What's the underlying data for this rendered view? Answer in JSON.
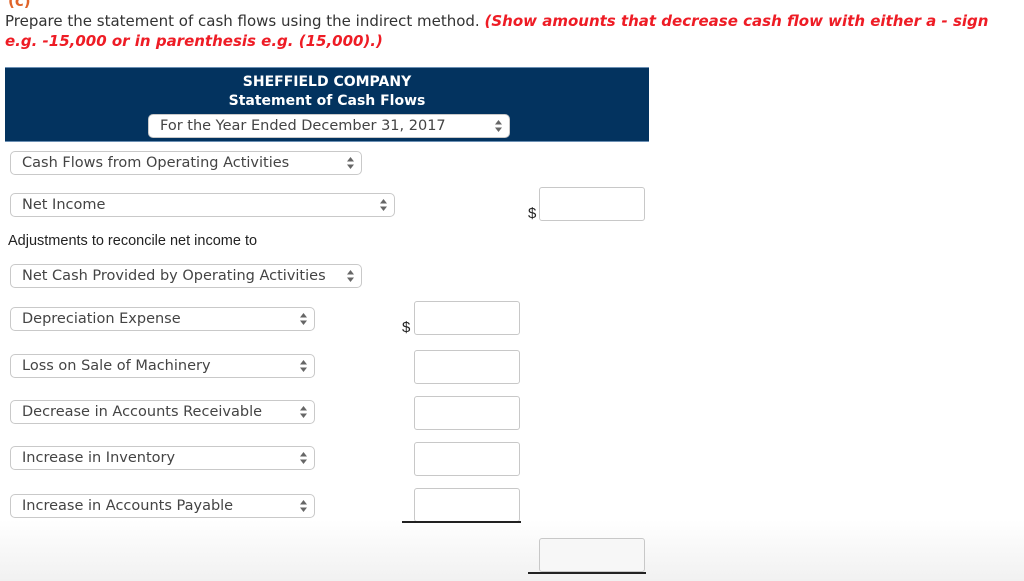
{
  "instructions": {
    "top_clipped": "(c)",
    "text": "Prepare the statement of cash flows using the indirect method.",
    "note": "(Show amounts that decrease cash flow with either a - sign e.g. -15,000 or in parenthesis e.g. (15,000).)"
  },
  "header": {
    "company": "SHEFFIELD COMPANY",
    "statement": "Statement of Cash Flows",
    "period_select": "For the Year Ended December 31, 2017",
    "bg_color": "#03335f"
  },
  "section_select": "Cash Flows from Operating Activities",
  "net_income": {
    "select": "Net Income",
    "currency": "$",
    "value": ""
  },
  "adjustments_label": "Adjustments to reconcile net income to",
  "adjustments_select": "Net Cash Provided by Operating Activities",
  "adjustments": [
    {
      "select": "Depreciation Expense",
      "currency": "$",
      "value": ""
    },
    {
      "select": "Loss on Sale of Machinery",
      "currency": "",
      "value": ""
    },
    {
      "select": "Decrease in Accounts Receivable",
      "currency": "",
      "value": ""
    },
    {
      "select": "Increase in Inventory",
      "currency": "",
      "value": ""
    },
    {
      "select": "Increase in Accounts Payable",
      "currency": "",
      "value": ""
    }
  ],
  "total_value": "",
  "colors": {
    "instruction_red": "#ee1c25",
    "header_bg": "#03335f"
  }
}
